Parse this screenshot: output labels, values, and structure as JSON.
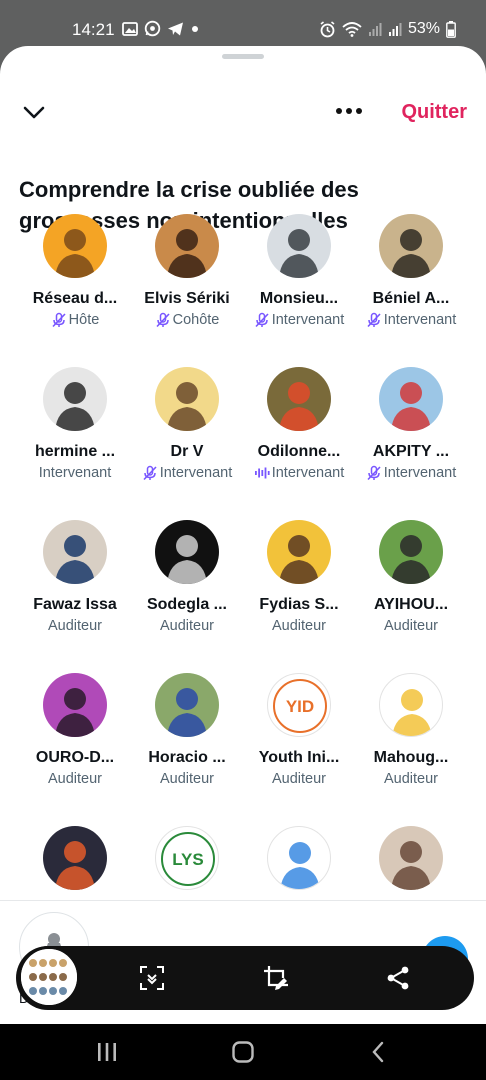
{
  "status_bar": {
    "time": "14:21",
    "battery_text": "53%",
    "icons_left": [
      "image-icon",
      "whatsapp-icon",
      "telegram-icon",
      "dot-icon"
    ],
    "icons_right": [
      "alarm-icon",
      "wifi-icon",
      "signal-icon",
      "signal-icon",
      "battery-icon"
    ]
  },
  "header": {
    "collapse_icon": "chevron-down-icon",
    "more_icon": "more-dots-icon",
    "quit_label": "Quitter"
  },
  "space": {
    "title": "Comprendre la crise oubliée des grossesses non intentionnelles"
  },
  "participants": [
    {
      "name": "Réseau d...",
      "role": "Hôte",
      "status_icon": "mic-off-icon",
      "avatar_bg": "#f4a425",
      "avatar_fg": "#7a4b1a"
    },
    {
      "name": "Elvis Sériki",
      "role": "Cohôte",
      "status_icon": "mic-off-icon",
      "avatar_bg": "#c98a4a",
      "avatar_fg": "#3b2214"
    },
    {
      "name": "Monsieu...",
      "role": "Intervenant",
      "status_icon": "mic-off-icon",
      "avatar_bg": "#d8dde2",
      "avatar_fg": "#3a3f44"
    },
    {
      "name": "Béniel A...",
      "role": "Intervenant",
      "status_icon": "mic-off-icon",
      "avatar_bg": "#c9b38c",
      "avatar_fg": "#2f2a22"
    },
    {
      "name": "hermine ...",
      "role": "Intervenant",
      "status_icon": "",
      "avatar_bg": "#e6e6e6",
      "avatar_fg": "#2a2a2a"
    },
    {
      "name": "Dr V",
      "role": "Intervenant",
      "status_icon": "mic-off-icon",
      "avatar_bg": "#f2d98a",
      "avatar_fg": "#6b4a2a"
    },
    {
      "name": "Odilonne...",
      "role": "Intervenant",
      "status_icon": "speaking-wave-icon",
      "avatar_bg": "#7a6a3a",
      "avatar_fg": "#e24a2a"
    },
    {
      "name": "AKPITY ...",
      "role": "Intervenant",
      "status_icon": "mic-off-icon",
      "avatar_bg": "#9cc6e6",
      "avatar_fg": "#d23a3a"
    },
    {
      "name": "Fawaz Issa",
      "role": "Auditeur",
      "status_icon": "",
      "avatar_bg": "#d8cfc4",
      "avatar_fg": "#1b3a6b"
    },
    {
      "name": "Sodegla ...",
      "role": "Auditeur",
      "status_icon": "",
      "avatar_bg": "#111111",
      "avatar_fg": "#cfcfcf"
    },
    {
      "name": "Fydias S...",
      "role": "Auditeur",
      "status_icon": "",
      "avatar_bg": "#f2c23a",
      "avatar_fg": "#5a3a22"
    },
    {
      "name": "AYIHOU...",
      "role": "Auditeur",
      "status_icon": "",
      "avatar_bg": "#6aa04a",
      "avatar_fg": "#2a2a2a"
    },
    {
      "name": "OURO-D...",
      "role": "Auditeur",
      "status_icon": "",
      "avatar_bg": "#b04ab8",
      "avatar_fg": "#2a1a2a"
    },
    {
      "name": "Horacio ...",
      "role": "Auditeur",
      "status_icon": "",
      "avatar_bg": "#8aa86a",
      "avatar_fg": "#2a4aa8"
    },
    {
      "name": "Youth Ini...",
      "role": "Auditeur",
      "status_icon": "",
      "avatar_bg": "#ffffff",
      "avatar_fg": "#e8702a",
      "logo_text": "YID"
    },
    {
      "name": "Mahoug...",
      "role": "Auditeur",
      "status_icon": "",
      "avatar_bg": "#ffffff",
      "avatar_fg": "#f2c23a"
    },
    {
      "name": "",
      "role": "",
      "status_icon": "",
      "avatar_bg": "#2a2a3a",
      "avatar_fg": "#e25a2a"
    },
    {
      "name": "",
      "role": "",
      "status_icon": "",
      "avatar_bg": "#ffffff",
      "avatar_fg": "#2a8a3a",
      "logo_text": "LYS"
    },
    {
      "name": "",
      "role": "",
      "status_icon": "",
      "avatar_bg": "#ffffff",
      "avatar_fg": "#3a8ae2"
    },
    {
      "name": "",
      "role": "",
      "status_icon": "",
      "avatar_bg": "#d8c8b8",
      "avatar_fg": "#6a4a3a"
    }
  ],
  "bottom": {
    "mini_letter": "D"
  },
  "screenshot_toolbar": {
    "buttons": [
      "scroll-capture-icon",
      "crop-edit-icon",
      "share-icon"
    ]
  },
  "nav_bar": {
    "buttons": [
      "recent-apps-icon",
      "home-icon",
      "back-icon"
    ]
  },
  "colors": {
    "accent_red": "#e0245e",
    "text_primary": "#0f1419",
    "text_secondary": "#536471",
    "speaking_purple": "#7856ff",
    "mic_off_purple": "#7856ff",
    "blue": "#1d9bf0"
  }
}
